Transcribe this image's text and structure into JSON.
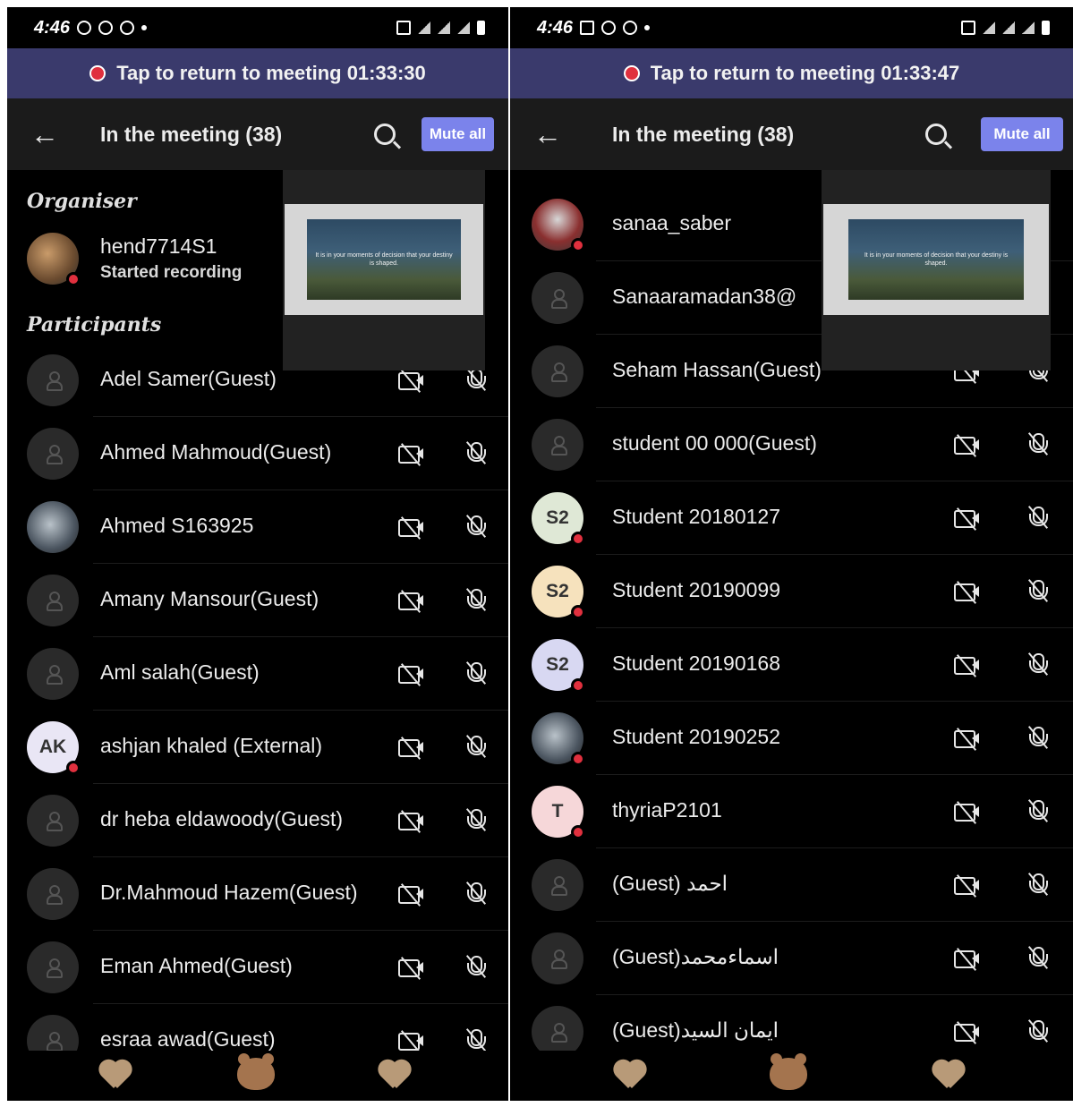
{
  "left": {
    "status": {
      "time": "4:46"
    },
    "banner": {
      "text": "Tap to return to meeting 01:33:30"
    },
    "appbar": {
      "title": "In the meeting (38)",
      "mute_all": "Mute all"
    },
    "organiser": {
      "section_label": "Organiser",
      "name": "hend7714S1",
      "status": "Started recording"
    },
    "participants_label": "Participants",
    "participants": [
      {
        "name": "Adel Samer(Guest)"
      },
      {
        "name": "Ahmed Mahmoud(Guest)"
      },
      {
        "name": "Ahmed S163925"
      },
      {
        "name": "Amany Mansour(Guest)"
      },
      {
        "name": "Aml salah(Guest)"
      },
      {
        "name": "ashjan khaled (External)",
        "initials": "AK"
      },
      {
        "name": "dr heba eldawoody(Guest)"
      },
      {
        "name": "Dr.Mahmoud Hazem(Guest)"
      },
      {
        "name": "Eman Ahmed(Guest)"
      },
      {
        "name": "esraa awad(Guest)"
      }
    ],
    "slide_text": "It is in your moments of decision that your destiny is shaped."
  },
  "right": {
    "status": {
      "time": "4:46"
    },
    "banner": {
      "text": "Tap to return to meeting 01:33:47"
    },
    "appbar": {
      "title": "In the meeting (38)",
      "mute_all": "Mute all"
    },
    "participants": [
      {
        "name": "sanaa_saber"
      },
      {
        "name": "Sanaaramadan38@"
      },
      {
        "name": "Seham Hassan(Guest)"
      },
      {
        "name": "student 00 000(Guest)"
      },
      {
        "name": "Student 20180127",
        "initials": "S2",
        "color": "#dfe8d6"
      },
      {
        "name": "Student 20190099",
        "initials": "S2",
        "color": "#f6e2bd"
      },
      {
        "name": "Student 20190168",
        "initials": "S2",
        "color": "#d8d8f2"
      },
      {
        "name": "Student 20190252"
      },
      {
        "name": "thyriaP2101",
        "initials": "T",
        "color": "#f6d7d9"
      },
      {
        "name": "(Guest) احمد"
      },
      {
        "name": "(Guest)اسماءمحمد"
      },
      {
        "name": "(Guest)ايمان السيد"
      }
    ],
    "slide_text": "It is in your moments of decision that your destiny is shaped."
  },
  "colors": {
    "banner": "#3a3a6c",
    "mute_all_button": "#7b83eb",
    "presence_busy": "#e0303e",
    "appbar": "#1b1b1b"
  }
}
